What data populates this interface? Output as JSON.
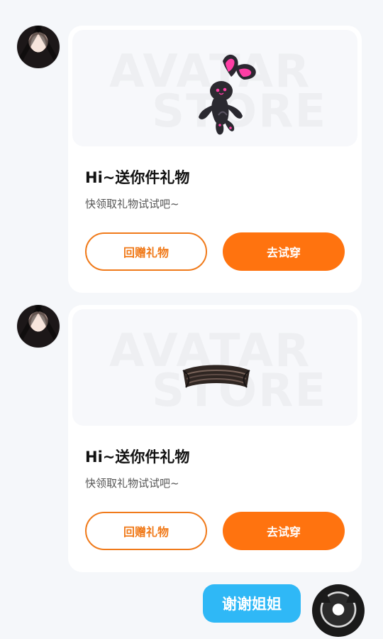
{
  "messages": [
    {
      "title": "Hi~送你件礼物",
      "subtitle": "快领取礼物试试吧~",
      "return_button": "回赠礼物",
      "try_button": "去试穿",
      "watermark_top": "AVATAR",
      "watermark_bottom": "STORE",
      "item_icon": "bunny-plush-icon"
    },
    {
      "title": "Hi~送你件礼物",
      "subtitle": "快领取礼物试试吧~",
      "return_button": "回赠礼物",
      "try_button": "去试穿",
      "watermark_top": "AVATAR",
      "watermark_bottom": "STORE",
      "item_icon": "headband-icon"
    }
  ],
  "reply": {
    "text": "谢谢姐姐"
  },
  "colors": {
    "accent_orange": "#ff730f",
    "reply_blue": "#2fb8f6",
    "page_bg": "#f5f7fa"
  }
}
